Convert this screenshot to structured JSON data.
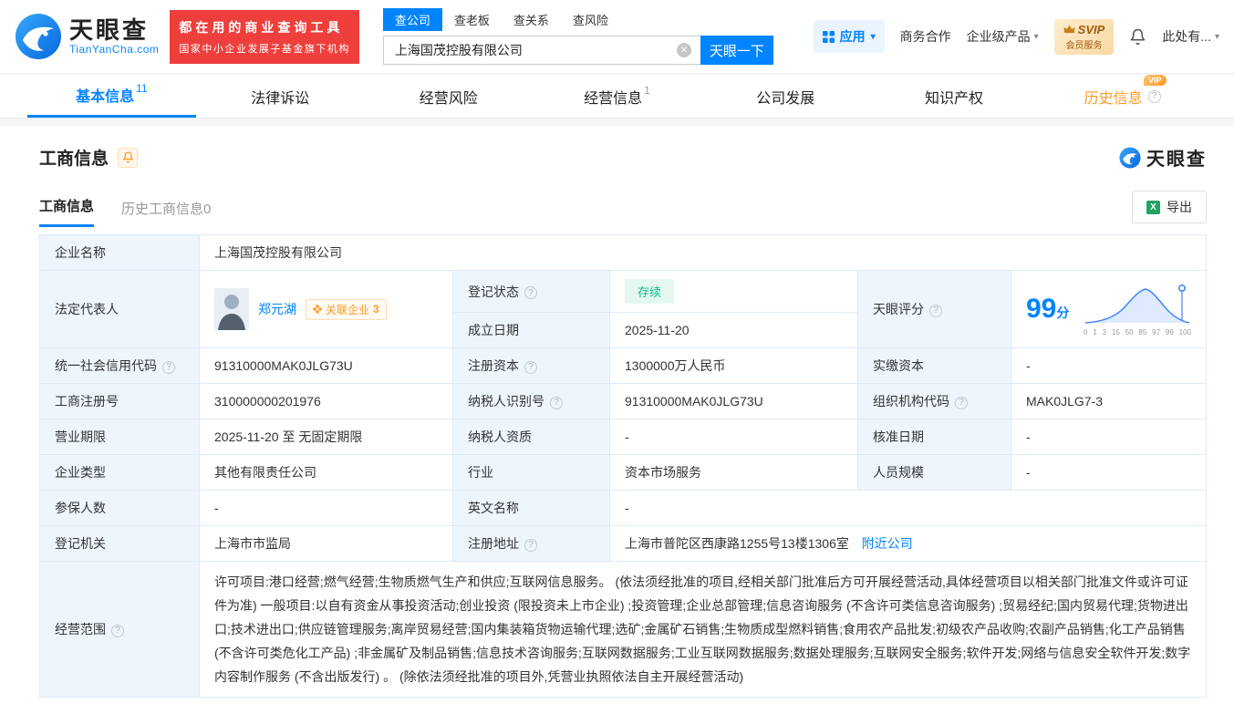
{
  "header": {
    "brand": {
      "name": "天眼查",
      "domain": "TianYanCha.com"
    },
    "promo": {
      "line1": "都在用的商业查询工具",
      "line2": "国家中小企业发展子基金旗下机构"
    },
    "search": {
      "tabs": [
        {
          "label": "查公司"
        },
        {
          "label": "查老板"
        },
        {
          "label": "查关系"
        },
        {
          "label": "查风险"
        }
      ],
      "value": "上海国茂控股有限公司",
      "button": "天眼一下"
    },
    "links": {
      "apps": "应用",
      "cooperation": "商务合作",
      "enterprise": "企业级产品",
      "svip_top": "SVIP",
      "svip_bottom": "会员服务",
      "user": "此处有..."
    }
  },
  "nav": {
    "tabs": [
      {
        "label": "基本信息",
        "badge": "11"
      },
      {
        "label": "法律诉讼"
      },
      {
        "label": "经营风险"
      },
      {
        "label": "经营信息",
        "badge": "1"
      },
      {
        "label": "公司发展"
      },
      {
        "label": "知识产权"
      },
      {
        "label": "历史信息",
        "vip": "VIP"
      }
    ]
  },
  "section": {
    "title": "工商信息",
    "brand": "天眼查",
    "subtabs": [
      {
        "label": "工商信息"
      },
      {
        "label": "历史工商信息0"
      }
    ],
    "export_label": "导出"
  },
  "labels": {
    "company_name": "企业名称",
    "legal_rep": "法定代表人",
    "reg_status": "登记状态",
    "establish_date": "成立日期",
    "score": "天眼评分",
    "credit_code": "统一社会信用代码",
    "reg_capital": "注册资本",
    "paid_capital": "实缴资本",
    "reg_number": "工商注册号",
    "taxpayer_id": "纳税人识别号",
    "org_code": "组织机构代码",
    "business_term": "营业期限",
    "taxpayer_quality": "纳税人资质",
    "approval_date": "核准日期",
    "company_type": "企业类型",
    "industry": "行业",
    "staff_size": "人员规模",
    "insured_count": "参保人数",
    "english_name": "英文名称",
    "reg_authority": "登记机关",
    "reg_address": "注册地址",
    "business_scope": "经营范围"
  },
  "company": {
    "name": "上海国茂控股有限公司",
    "legal_rep": "郑元湖",
    "related_label": "关联企业",
    "related_count": "3",
    "reg_status": "存续",
    "establish_date": "2025-11-20",
    "credit_code": "91310000MAK0JLG73U",
    "reg_capital": "1300000万人民币",
    "paid_capital": "-",
    "reg_number": "310000000201976",
    "taxpayer_id": "91310000MAK0JLG73U",
    "org_code": "MAK0JLG7-3",
    "business_term": "2025-11-20 至 无固定期限",
    "taxpayer_quality": "-",
    "approval_date": "-",
    "company_type": "其他有限责任公司",
    "industry": "资本市场服务",
    "staff_size": "-",
    "insured_count": "-",
    "english_name": "-",
    "reg_authority": "上海市市监局",
    "reg_address": "上海市普陀区西康路1255号13楼1306室",
    "nearby_link": "附近公司",
    "business_scope": "许可项目:港口经营;燃气经营;生物质燃气生产和供应;互联网信息服务。 (依法须经批准的项目,经相关部门批准后方可开展经营活动,具体经营项目以相关部门批准文件或许可证件为准) 一般项目:以自有资金从事投资活动;创业投资 (限投资未上市企业) ;投资管理;企业总部管理;信息咨询服务 (不含许可类信息咨询服务) ;贸易经纪;国内贸易代理;货物进出口;技术进出口;供应链管理服务;离岸贸易经营;国内集装箱货物运输代理;选矿;金属矿石销售;生物质成型燃料销售;食用农产品批发;初级农产品收购;农副产品销售;化工产品销售 (不含许可类危化工产品) ;非金属矿及制品销售;信息技术咨询服务;互联网数据服务;工业互联网数据服务;数据处理服务;互联网安全服务;软件开发;网络与信息安全软件开发;数字内容制作服务 (不含出版发行) 。 (除依法须经批准的项目外,凭营业执照依法自主开展经营活动)"
  },
  "score_chart": {
    "score": "99",
    "unit": "分",
    "ticks": [
      "0",
      "1",
      "3",
      "15",
      "50",
      "85",
      "97",
      "99",
      "100"
    ]
  },
  "colors": {
    "primary_blue": "#0084ff",
    "brand_red": "#ee3f3c",
    "vip_orange": "#ff9924",
    "status_green": "#0dbd8d"
  }
}
